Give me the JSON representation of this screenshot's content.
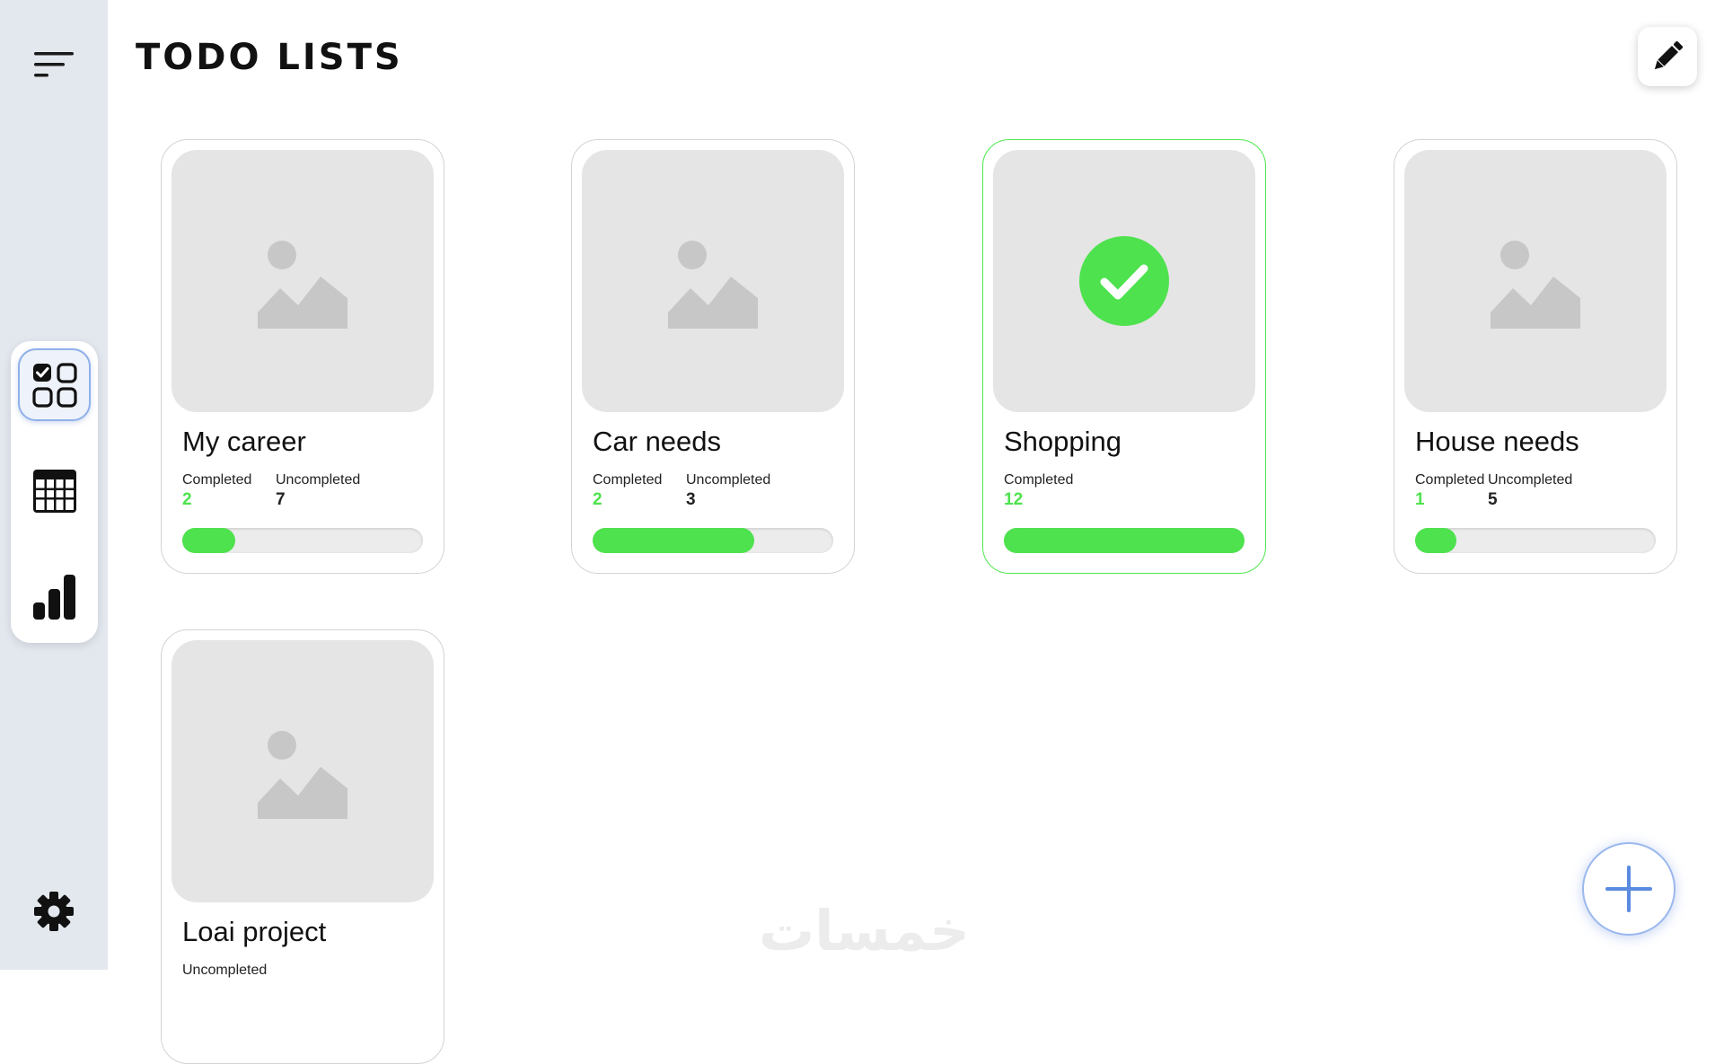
{
  "page": {
    "title": "TODO LISTS"
  },
  "colors": {
    "accent_green": "#4ee24e",
    "sidebar_bg": "#e3e8ef",
    "active_nav_border": "#8fb0ea"
  },
  "sidebar": {
    "menu_icon": "menu-lines-icon",
    "nav": [
      {
        "icon": "checklist-grid-icon",
        "active": true
      },
      {
        "icon": "table-calendar-icon",
        "active": false
      },
      {
        "icon": "bar-chart-icon",
        "active": false
      }
    ],
    "settings_icon": "gear-icon"
  },
  "header": {
    "edit_icon": "pencil-icon"
  },
  "lists": [
    {
      "title": "My career",
      "completed_label": "Completed",
      "completed": "2",
      "uncompleted_label": "Uncompleted",
      "uncompleted": "7",
      "progress": 0.22,
      "done": false
    },
    {
      "title": "Car needs",
      "completed_label": "Completed",
      "completed": "2",
      "uncompleted_label": "Uncompleted",
      "uncompleted": "3",
      "progress": 0.67,
      "done": false
    },
    {
      "title": "Shopping",
      "completed_label": "Completed",
      "completed": "12",
      "progress": 1.0,
      "done": true
    },
    {
      "title": "House needs",
      "completed_label": "Completed",
      "completed": "1",
      "uncompleted_label": "Uncompleted",
      "uncompleted": "5",
      "progress": 0.17,
      "done": false
    },
    {
      "title": "Loai project",
      "uncompleted_label": "Uncompleted",
      "done": false
    }
  ],
  "fab": {
    "icon": "plus-icon"
  },
  "watermark": {
    "text": "خمسات"
  }
}
